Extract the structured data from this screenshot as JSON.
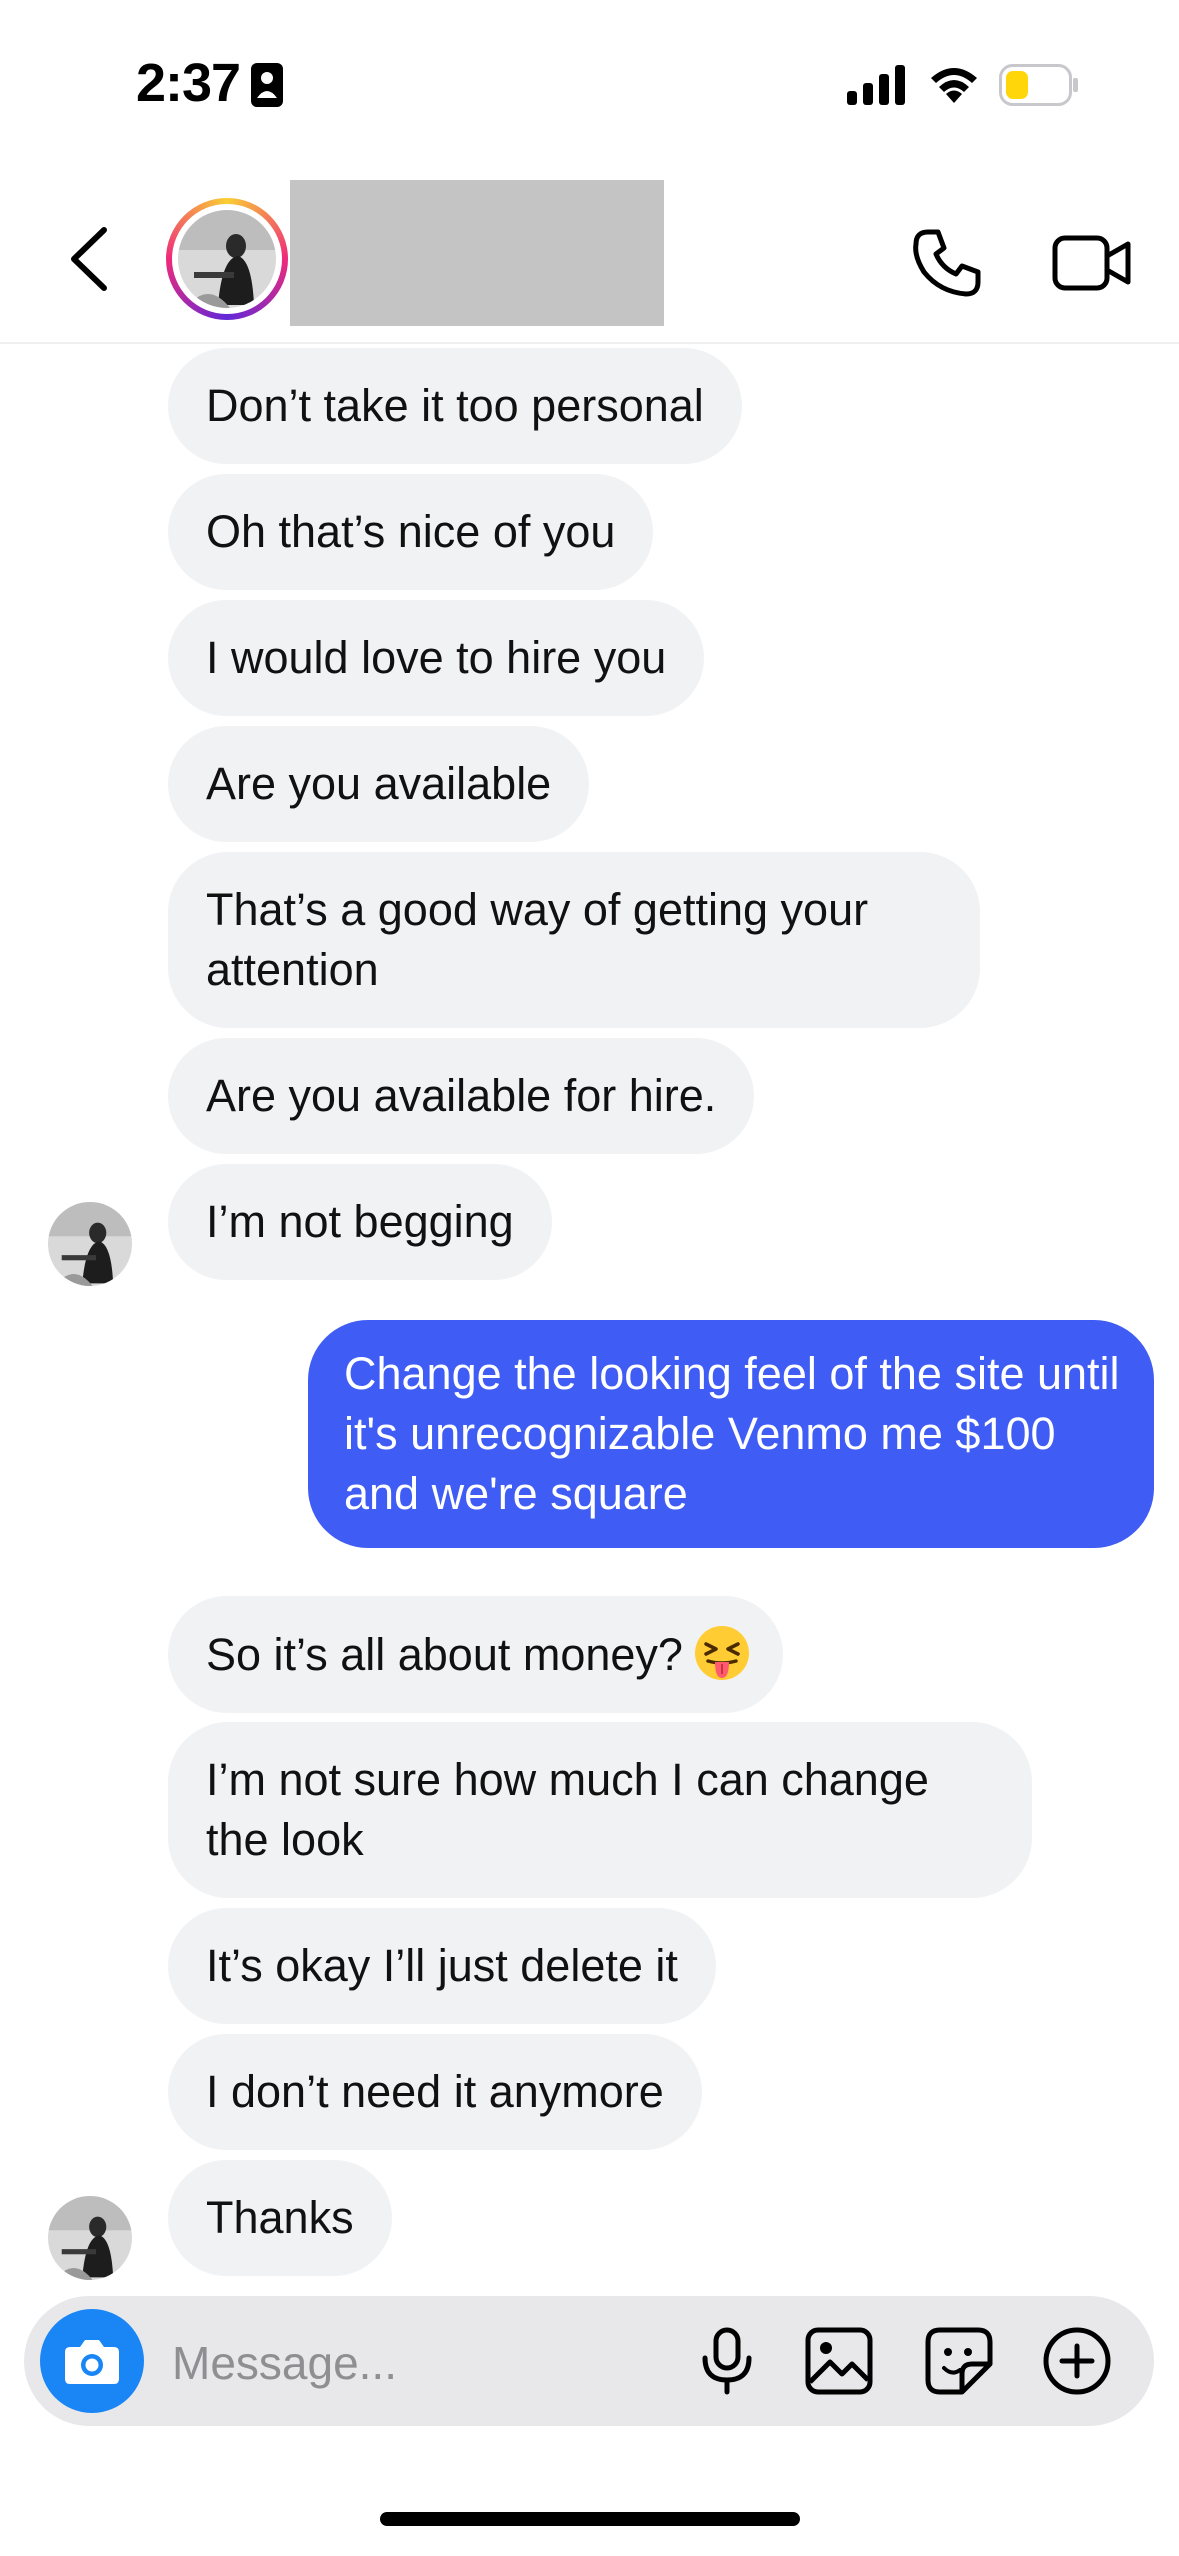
{
  "status_bar": {
    "time": "2:37"
  },
  "header": {
    "contact_name": ""
  },
  "messages": [
    {
      "text": "Don’t take it too personal",
      "from": "them"
    },
    {
      "text": "Oh that’s nice of you",
      "from": "them"
    },
    {
      "text": "I would love to hire you",
      "from": "them"
    },
    {
      "text": "Are you available",
      "from": "them"
    },
    {
      "text": "That’s a good way of getting your attention",
      "from": "them"
    },
    {
      "text": "Are you available for hire.",
      "from": "them"
    },
    {
      "text": "I’m not begging",
      "from": "them"
    },
    {
      "text": "Change the looking feel of the site until it's unrecognizable Venmo me $100 and we're square",
      "from": "me"
    },
    {
      "text": "So it’s all about money?",
      "from": "them",
      "emoji": "squinting-face-with-tongue-emoji"
    },
    {
      "text": "I’m not sure how much I can change the look",
      "from": "them"
    },
    {
      "text": "It’s okay I’ll just delete it",
      "from": "them"
    },
    {
      "text": "I don’t need it anymore",
      "from": "them"
    },
    {
      "text": "Thanks",
      "from": "them"
    }
  ],
  "composer": {
    "placeholder": "Message..."
  },
  "colors": {
    "incoming_bubble": "#f1f2f4",
    "outgoing_bubble": "#3f5cf5",
    "camera_button": "#1a86f5",
    "battery_fill": "#ffd60a"
  },
  "icons": [
    "person-badge-icon",
    "cellular-signal-icon",
    "wifi-icon",
    "battery-icon",
    "back-chevron-icon",
    "phone-icon",
    "video-camera-icon",
    "camera-icon",
    "microphone-icon",
    "gallery-icon",
    "sticker-icon",
    "plus-circle-icon"
  ]
}
